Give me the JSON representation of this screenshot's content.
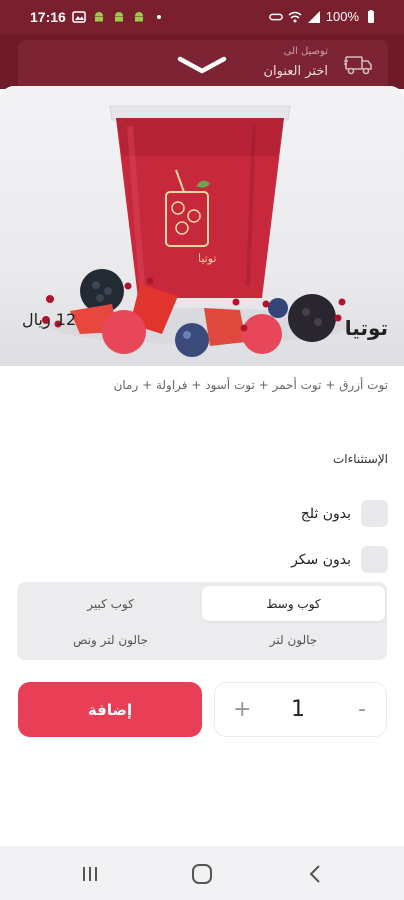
{
  "status_bar": {
    "time": "17:16",
    "battery": "100%"
  },
  "delivery": {
    "label": "توصيل الى",
    "address": "اختر العنوان"
  },
  "product": {
    "name": "توتيا",
    "price": "12 ريال",
    "description": "توت أزرق + توت أحمر + توت أسود + فراولة + رمان",
    "cup_logo_text": "توتيا"
  },
  "exclusions": {
    "title": "الإستثناءات",
    "options": [
      {
        "label": "بدون ثلج",
        "checked": false
      },
      {
        "label": "بدون سكر",
        "checked": false
      }
    ]
  },
  "sizes": [
    {
      "label": "كوب وسط",
      "selected": true
    },
    {
      "label": "كوب كبير",
      "selected": false
    },
    {
      "label": "جالون لتر",
      "selected": false
    },
    {
      "label": "جالون لتر ونص",
      "selected": false
    }
  ],
  "quantity": {
    "value": "1",
    "plus": "+",
    "minus": "-"
  },
  "actions": {
    "add_label": "إضافة"
  },
  "colors": {
    "brand_dark": "#7a1f2e",
    "accent": "#e83e56",
    "juice": "#c8283c"
  },
  "icons": [
    "wifi-icon",
    "signal-icon",
    "battery-icon",
    "truck-icon",
    "chevron-down-icon",
    "recents-icon",
    "home-icon",
    "back-icon"
  ]
}
